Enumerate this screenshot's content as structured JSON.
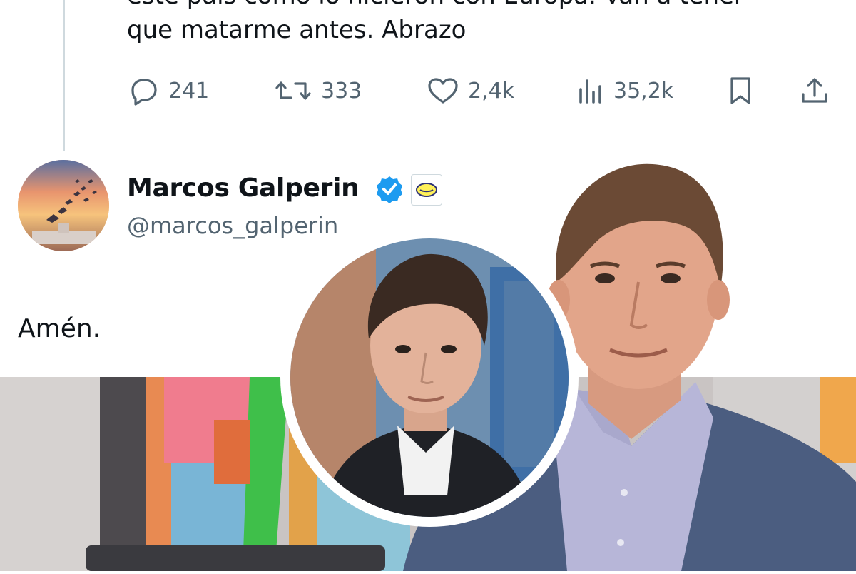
{
  "tweet_above": {
    "text_line1": "este país como lo hicieron con Europa. Van a tener",
    "text_line2": "que matarme antes. Abrazo",
    "actions": {
      "reply": {
        "icon": "reply-icon",
        "count": "241"
      },
      "retweet": {
        "icon": "retweet-icon",
        "count": "333"
      },
      "like": {
        "icon": "heart-icon",
        "count": "2,4k"
      },
      "views": {
        "icon": "views-icon",
        "count": "35,2k"
      },
      "bookmark": {
        "icon": "bookmark-icon"
      },
      "share": {
        "icon": "share-icon"
      }
    }
  },
  "reply_tweet": {
    "author_name": "Marcos Galperin",
    "author_handle": "@marcos_galperin",
    "verified": true,
    "affiliate_badge": "company-badge-icon",
    "text": "Amén."
  },
  "colors": {
    "text_primary": "#0f1419",
    "text_secondary": "#536471",
    "verified_blue": "#1d9bf0",
    "thread_line": "#cfd9de"
  }
}
